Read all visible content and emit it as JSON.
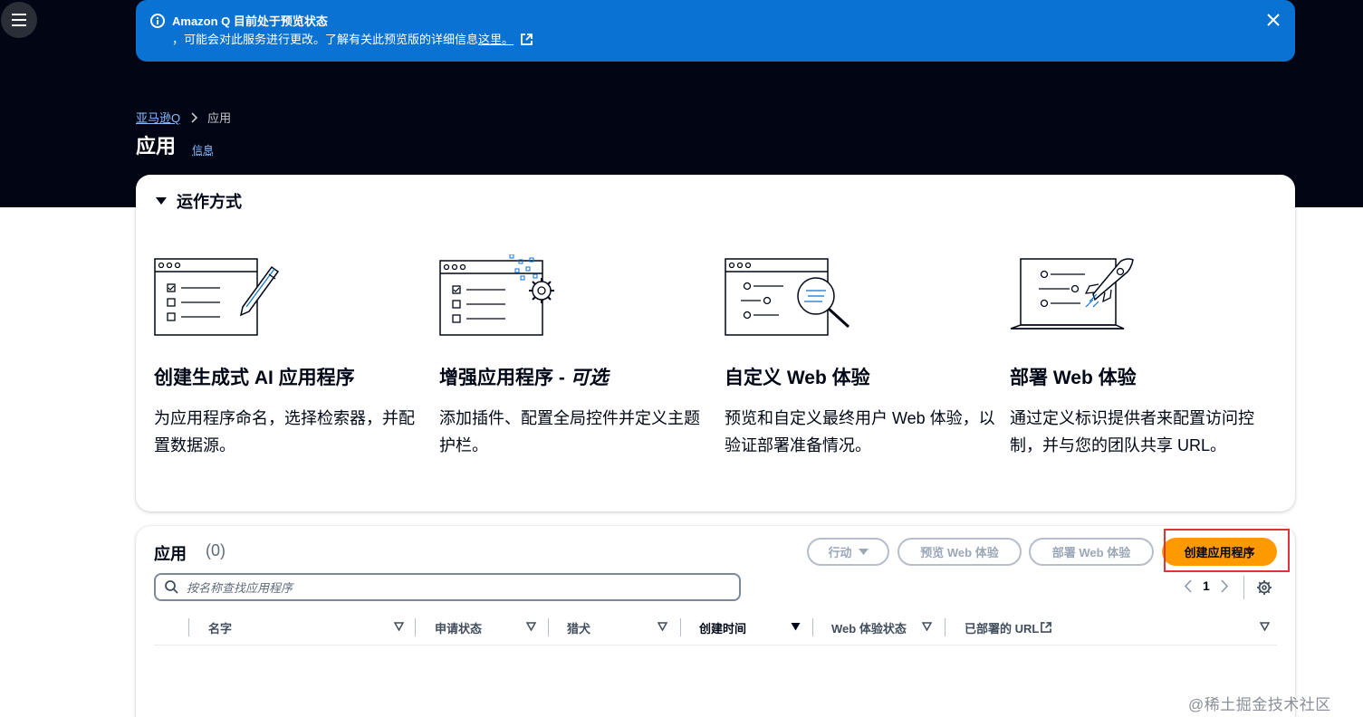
{
  "flash": {
    "title": "Amazon Q 目前处于预览状态",
    "body_prefix": "，可能会对此服务进行更改。了解有关此预览版的详细信息",
    "body_link": "这里。",
    "colors": {
      "background": "#0972d3"
    }
  },
  "breadcrumb": {
    "root": "亚马逊Q",
    "current": "应用"
  },
  "page": {
    "title": "应用",
    "info_link": "信息"
  },
  "how_it_works": {
    "heading": "运作方式",
    "steps": [
      {
        "title": "创建生成式 AI 应用程序",
        "title_suffix": "",
        "description": "为应用程序命名，选择检索器，并配置数据源。",
        "icon": "form-pencil-illustration"
      },
      {
        "title": "增强应用程序 - ",
        "title_suffix": "可选",
        "description": "添加插件、配置全局控件并定义主题护栏。",
        "icon": "form-gear-illustration"
      },
      {
        "title": "自定义 Web 体验",
        "title_suffix": "",
        "description": "预览和自定义最终用户 Web 体验，以验证部署准备情况。",
        "icon": "browser-magnifier-illustration"
      },
      {
        "title": "部署 Web 体验",
        "title_suffix": "",
        "description": "通过定义标识提供者来配置访问控制，并与您的团队共享 URL。",
        "icon": "laptop-rocket-illustration"
      }
    ]
  },
  "apps_table": {
    "title": "应用",
    "count": "(0)",
    "buttons": {
      "actions": "行动",
      "preview": "预览 Web 体验",
      "deploy": "部署 Web 体验",
      "create": "创建应用程序"
    },
    "search_placeholder": "按名称查找应用程序",
    "page_number": "1",
    "columns": [
      "名字",
      "申请状态",
      "猎犬",
      "创建时间",
      "Web 体验状态",
      "已部署的 URL"
    ],
    "colors": {
      "primary_button": "#ff9900",
      "highlight": "#e0343a"
    }
  },
  "watermark": "@稀土掘金技术社区"
}
